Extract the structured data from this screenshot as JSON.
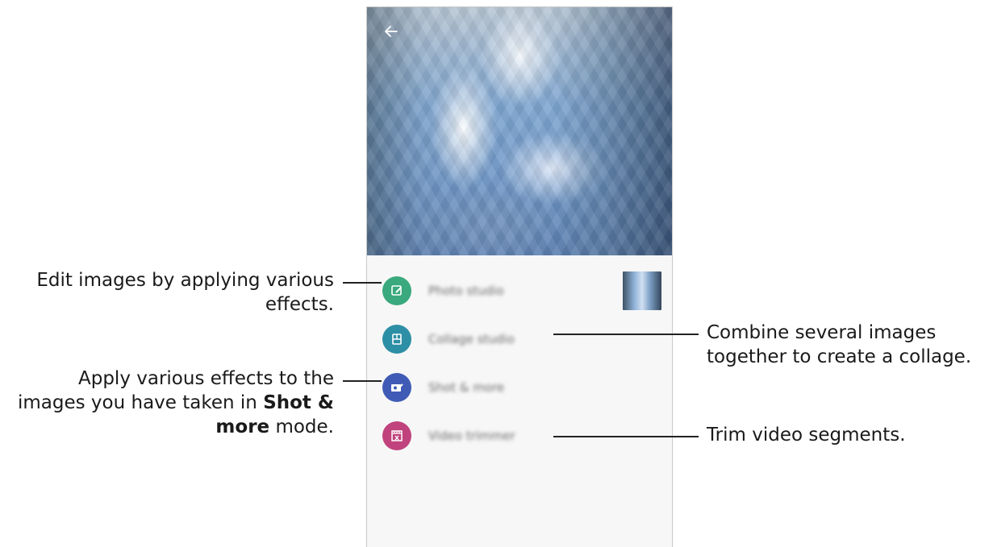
{
  "app": {
    "back_icon": "arrow-left-icon"
  },
  "menu": {
    "items": [
      {
        "label": "Photo studio",
        "icon": "photo-edit-icon",
        "color": "#3aa97d"
      },
      {
        "label": "Collage studio",
        "icon": "collage-icon",
        "color": "#2d8fa5"
      },
      {
        "label": "Shot & more",
        "icon": "shot-more-icon",
        "color": "#3f5bb5"
      },
      {
        "label": "Video trimmer",
        "icon": "video-trim-icon",
        "color": "#c0437d"
      }
    ]
  },
  "callouts": {
    "photo_studio": {
      "line1": "Edit images by applying various",
      "line2": "effects."
    },
    "shot_more": {
      "line1": "Apply various effects to the",
      "line2_pre": "images you have taken in ",
      "line2_bold": "Shot &",
      "line3_bold": "more",
      "line3_post": " mode."
    },
    "collage_studio": {
      "line1": "Combine several images",
      "line2": "together to create a collage."
    },
    "video_trimmer": {
      "line1": "Trim video segments."
    }
  }
}
